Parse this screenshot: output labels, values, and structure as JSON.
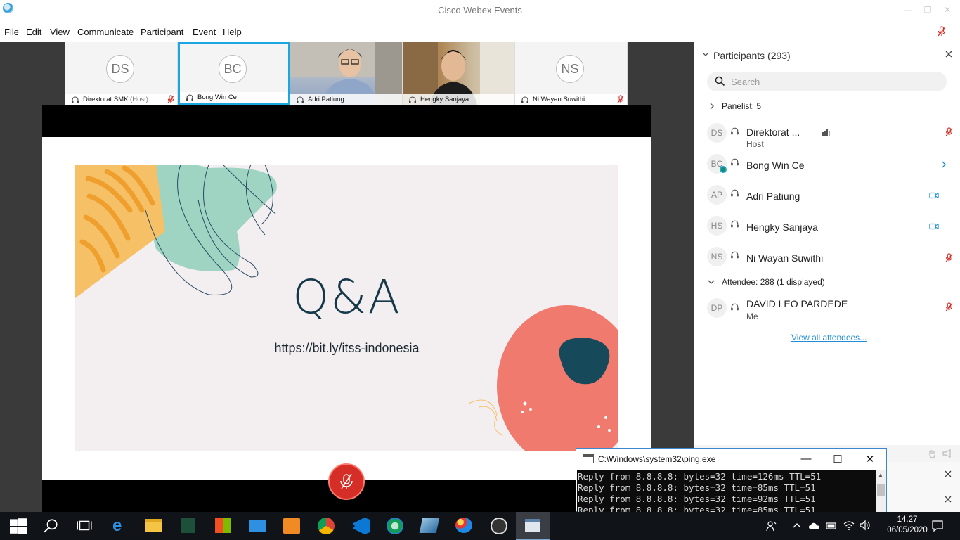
{
  "window": {
    "title": "Cisco Webex Events"
  },
  "menu": [
    {
      "label": "File"
    },
    {
      "label": "Edit"
    },
    {
      "label": "View"
    },
    {
      "label": "Communicate"
    },
    {
      "label": "Participant"
    },
    {
      "label": "Event"
    },
    {
      "label": "Help"
    }
  ],
  "video_strip": [
    {
      "initials": "DS",
      "name": "Direktorat SMK",
      "host_tag": "(Host)",
      "muted": true
    },
    {
      "initials": "BC",
      "name": "Bong Win Ce",
      "active": true
    },
    {
      "name": "Adri Patiung",
      "video": true
    },
    {
      "name": "Hengky Sanjaya",
      "video": true
    },
    {
      "initials": "NS",
      "name": "Ni Wayan Suwithi",
      "muted": true
    }
  ],
  "slide": {
    "title": "Q&A",
    "url": "https://bit.ly/itss-indonesia"
  },
  "participants": {
    "header": "Participants (293)",
    "search_placeholder": "Search",
    "panelist_group": "Panelist: 5",
    "attendee_group": "Attendee: 288 (1 displayed)",
    "view_all": "View all attendees...",
    "panelists": [
      {
        "initials": "DS",
        "name": "Direktorat ...",
        "role": "Host",
        "status": "muted"
      },
      {
        "initials": "BC",
        "name": "Bong Win Ce",
        "role": "",
        "status": "presenting"
      },
      {
        "initials": "AP",
        "name": "Adri Patiung",
        "role": "",
        "status": "video"
      },
      {
        "initials": "HS",
        "name": "Hengky Sanjaya",
        "role": "",
        "status": "video"
      },
      {
        "initials": "NS",
        "name": "Ni Wayan Suwithi",
        "role": "",
        "status": "muted"
      }
    ],
    "attendees": [
      {
        "initials": "DP",
        "name": "DAVID LEO PARDEDE",
        "role": "Me",
        "status": "muted"
      }
    ]
  },
  "console": {
    "title": "C:\\Windows\\system32\\ping.exe",
    "lines": [
      "Reply from 8.8.8.8: bytes=32 time=126ms TTL=51",
      "Reply from 8.8.8.8: bytes=32 time=85ms TTL=51",
      "Reply from 8.8.8.8: bytes=32 time=92ms TTL=51",
      "Reply from 8.8.8.8: bytes=32 time=85ms TTL=51"
    ]
  },
  "taskbar": {
    "time": "14.27",
    "date": "06/05/2020"
  },
  "colors": {
    "accent": "#1aa6e0",
    "mute_red": "#d42e26",
    "slide_navy": "#16394a",
    "slide_coral": "#f07a6e",
    "slide_orange": "#f6b45a",
    "slide_mint": "#9fd3c2"
  }
}
